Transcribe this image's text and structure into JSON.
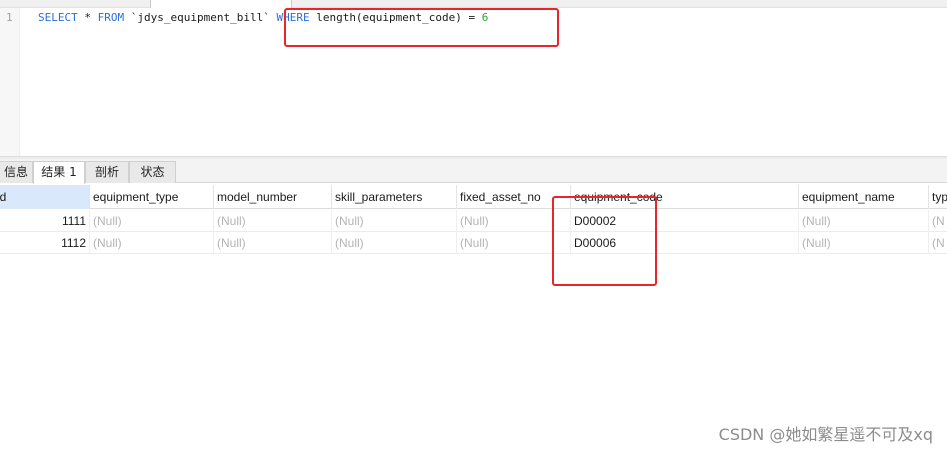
{
  "editor": {
    "line_number": "1",
    "sql": {
      "kw_select": "SELECT",
      "star_from_pre": " * ",
      "kw_from": "FROM",
      "table": " `jdys_equipment_bill` ",
      "kw_where": "WHERE",
      "condition": " length(equipment_code) = ",
      "value": "6"
    }
  },
  "tabs": {
    "info": "信息",
    "result": "结果 1",
    "profile": "剖析",
    "status": "状态"
  },
  "table": {
    "columns": [
      "id",
      "equipment_type",
      "model_number",
      "skill_parameters",
      "fixed_asset_no",
      "equipment_code",
      "equipment_name",
      "typ"
    ],
    "rows": [
      [
        "1111",
        "(Null)",
        "(Null)",
        "(Null)",
        "(Null)",
        "D00002",
        "(Null)",
        "(N"
      ],
      [
        "1112",
        "(Null)",
        "(Null)",
        "(Null)",
        "(Null)",
        "D00006",
        "(Null)",
        "(N"
      ]
    ]
  },
  "watermark": "CSDN @她如繁星遥不可及xq",
  "colors": {
    "keyword": "#2a6ed8",
    "number": "#2aa52a",
    "highlight": "#e8262a",
    "null_text": "#b4b4b4",
    "selected_header": "#d9e8fb"
  }
}
